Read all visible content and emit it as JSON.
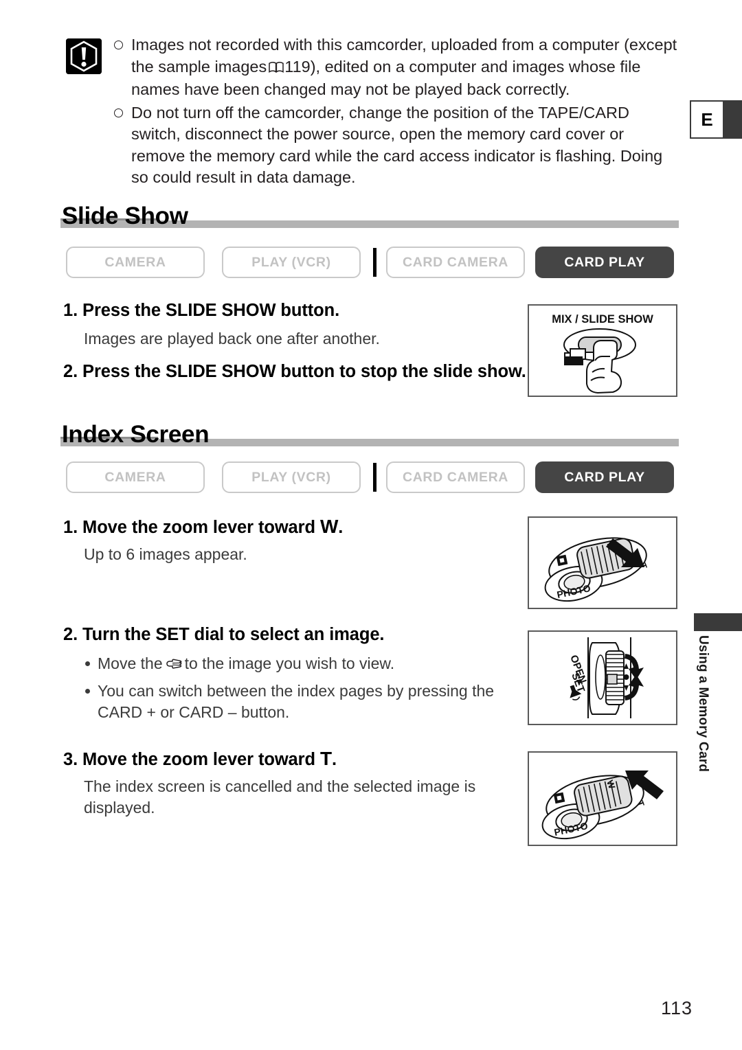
{
  "page": {
    "number": "113",
    "edge_tab_letter": "E",
    "side_caption": "Using a Memory Card"
  },
  "notes": {
    "icon": "warning-exclamation-icon",
    "items": [
      {
        "text_before": "Images not recorded with this camcorder, uploaded from a computer (except the sample images",
        "ref_icon": "book-icon",
        "ref_page": "119",
        "text_after": "), edited on a computer and images whose file names have been changed may not be played back correctly."
      },
      {
        "text_before": "Do not turn off the camcorder, change the position of the TAPE/CARD switch, disconnect the power source, open the memory card cover or remove the memory card while the card access indicator is flashing. Doing so could result in data damage.",
        "ref_icon": "",
        "ref_page": "",
        "text_after": ""
      }
    ]
  },
  "sections": [
    {
      "id": "slide-show",
      "title": "Slide Show",
      "modes": [
        {
          "label": "CAMERA",
          "active": false
        },
        {
          "label": "PLAY (VCR)",
          "active": false
        },
        {
          "label": "CARD CAMERA",
          "active": false
        },
        {
          "label": "CARD PLAY",
          "active": true
        }
      ],
      "steps": [
        {
          "title": "1. Press the SLIDE SHOW button.",
          "body": "Images are played back one after another."
        },
        {
          "title": "2. Press the SLIDE SHOW button to stop the slide show.",
          "body": ""
        }
      ]
    },
    {
      "id": "index-screen",
      "title": "Index Screen",
      "modes": [
        {
          "label": "CAMERA",
          "active": false
        },
        {
          "label": "PLAY (VCR)",
          "active": false
        },
        {
          "label": "CARD CAMERA",
          "active": false
        },
        {
          "label": "CARD PLAY",
          "active": true
        }
      ],
      "steps": [
        {
          "title_main": "1. Move the zoom lever toward ",
          "title_key": "W",
          "title_end": ".",
          "body": "Up to 6 images appear."
        },
        {
          "title_main": "2. Turn the SET dial to select an image.",
          "title_key": "",
          "title_end": "",
          "bullets": [
            {
              "before": "Move the",
              "icon": "pointing-hand-icon",
              "after": "to the image you wish to view."
            },
            {
              "before": "You can switch between the index pages by pressing the CARD + or CARD – button.",
              "icon": "",
              "after": ""
            }
          ]
        },
        {
          "title_main": "3. Move the zoom lever toward ",
          "title_key": "T",
          "title_end": ".",
          "body": "The index screen is cancelled and the selected image is displayed."
        }
      ]
    }
  ],
  "illustrations": [
    {
      "id": "slide-show-button",
      "label": "MIX / SLIDE SHOW",
      "name": "mix-slide-show-button-illustration"
    },
    {
      "id": "zoom-lever-wide",
      "label_w": "W",
      "label_t": "T",
      "label_photo": "PHOTO",
      "name": "zoom-lever-wide-illustration"
    },
    {
      "id": "set-dial",
      "label_open": "OPEN",
      "label_set": "SET",
      "name": "set-dial-illustration"
    },
    {
      "id": "zoom-lever-tele",
      "label_w": "W",
      "label_t": "T",
      "label_photo": "PHOTO",
      "name": "zoom-lever-tele-illustration"
    }
  ],
  "colors": {
    "active_mode_bg": "#454545",
    "inactive_mode_border": "#c9c9c9",
    "heading_rule": "#b3b3b3",
    "text": "#231f20"
  }
}
